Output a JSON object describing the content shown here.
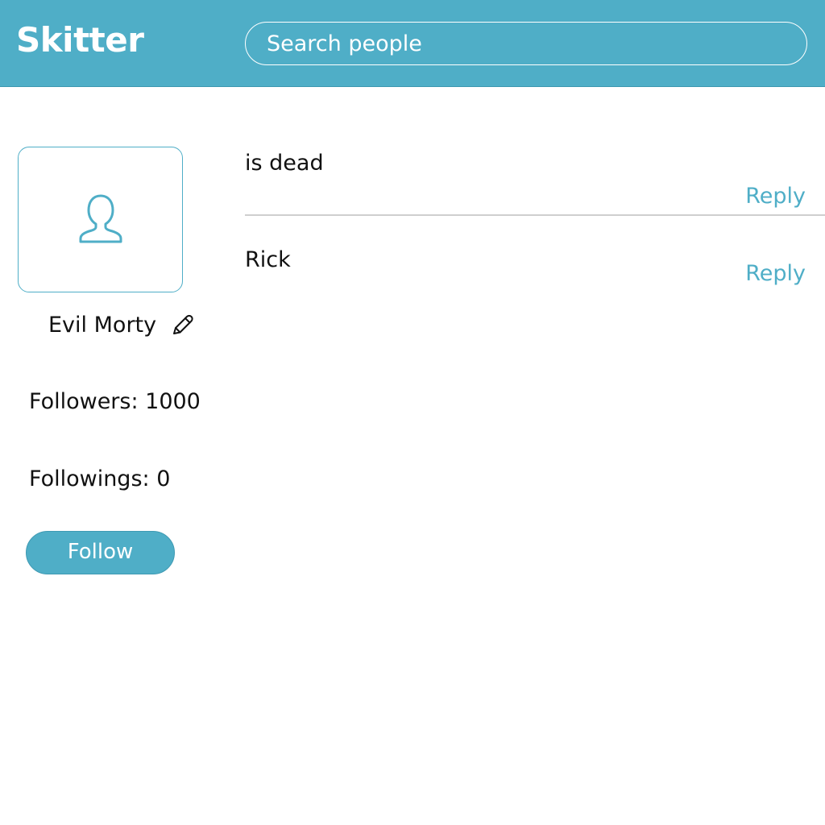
{
  "header": {
    "logo": "Skitter",
    "search_placeholder": "Search people"
  },
  "profile": {
    "avatar_icon": "user-outline-icon",
    "name": "Evil Morty",
    "edit_icon": "pencil-icon",
    "followers": "Followers: 1000",
    "followings": "Followings: 0",
    "follow_label": "Follow"
  },
  "feed": {
    "posts": [
      {
        "text": "is dead",
        "reply_label": "Reply"
      },
      {
        "text": "Rick",
        "reply_label": "Reply"
      }
    ]
  },
  "colors": {
    "accent": "#4FAEC7",
    "divider": "#CFCFCF",
    "text": "#111111"
  }
}
